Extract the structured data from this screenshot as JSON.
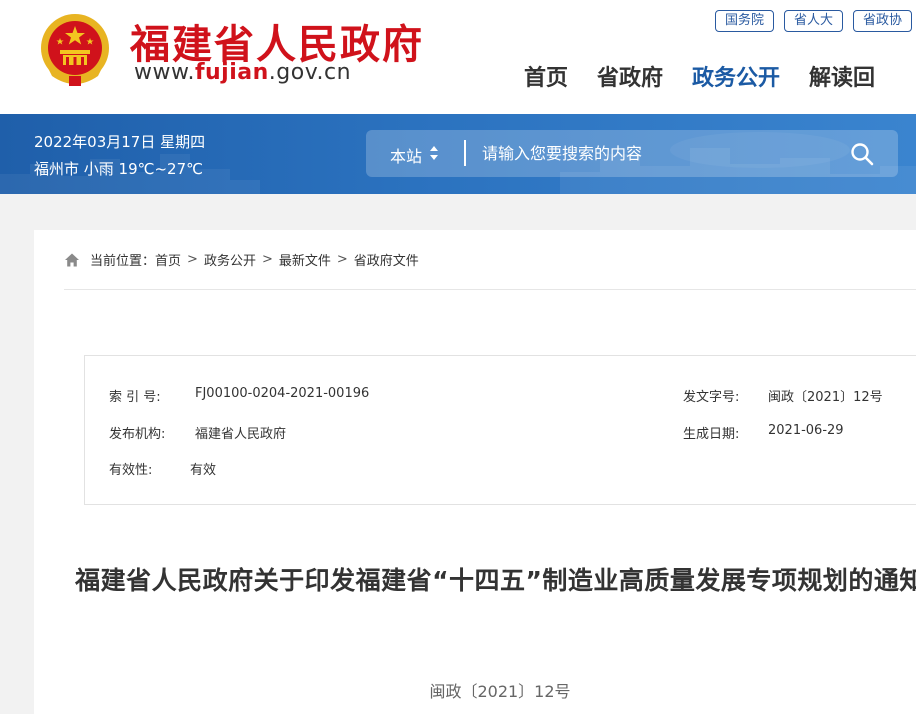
{
  "header": {
    "site_name": "福建省人民政府",
    "url_prefix": "www.",
    "url_highlight": "fujian",
    "url_suffix": ".gov.cn",
    "top_links": [
      "国务院",
      "省人大",
      "省政协"
    ],
    "nav": [
      {
        "label": "首页",
        "active": false
      },
      {
        "label": "省政府",
        "active": false
      },
      {
        "label": "政务公开",
        "active": true
      },
      {
        "label": "解读回",
        "active": false
      }
    ]
  },
  "banner": {
    "date": "2022年03月17日 星期四",
    "weather": "福州市 小雨 19℃~27℃",
    "search_scope": "本站",
    "search_placeholder": "请输入您要搜索的内容"
  },
  "breadcrumb": {
    "prefix": "当前位置：",
    "items": [
      "首页",
      "政务公开",
      "最新文件",
      "省政府文件"
    ],
    "separator": ">"
  },
  "meta": {
    "index_label": "索 引 号:",
    "index_value": "FJ00100-0204-2021-00196",
    "doc_no_label": "发文字号:",
    "doc_no_value": "闽政〔2021〕12号",
    "publisher_label": "发布机构:",
    "publisher_value": "福建省人民政府",
    "date_label": "生成日期:",
    "date_value": "2021-06-29",
    "validity_label": "有效性:",
    "validity_value": "有效"
  },
  "document": {
    "title": "福建省人民政府关于印发福建省“十四五”制造业高质量发展专项规划的通知",
    "number": "闽政〔2021〕12号"
  },
  "colors": {
    "brand_red": "#d0121b",
    "nav_active": "#1b5aa4",
    "banner_blue": "#1f5faa"
  },
  "icons": [
    "national-emblem-icon",
    "sort-arrows-icon",
    "search-icon",
    "home-icon"
  ]
}
